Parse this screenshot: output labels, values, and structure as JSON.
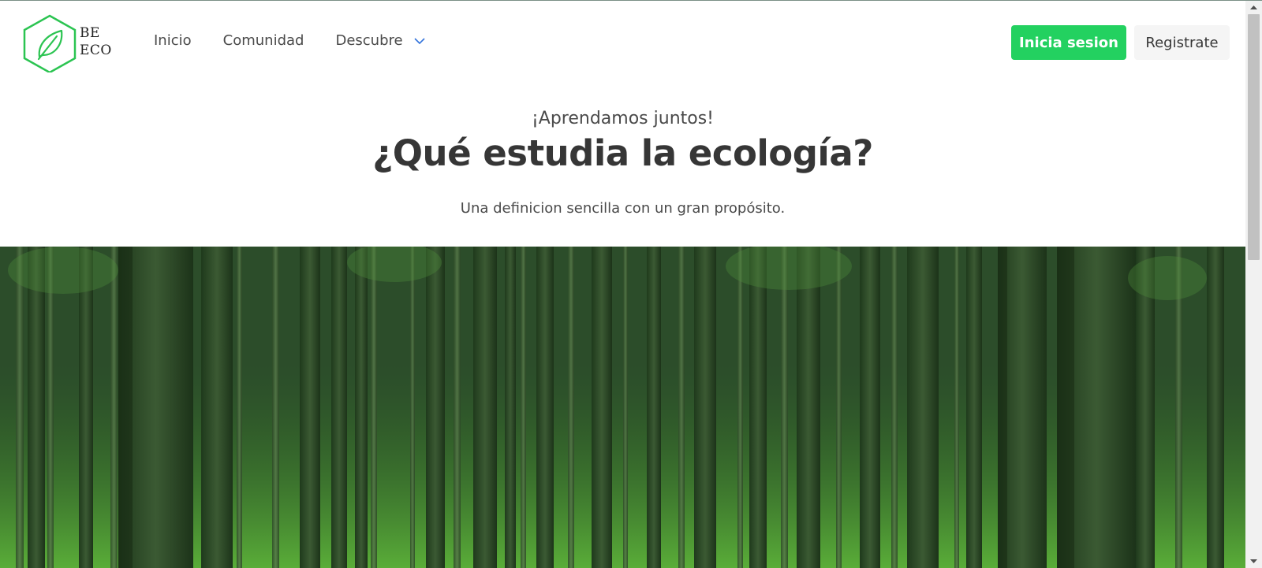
{
  "brand": {
    "line1": "BE",
    "line2": "ECO",
    "color": "#2bc451"
  },
  "nav": {
    "items": [
      {
        "label": "Inicio"
      },
      {
        "label": "Comunidad"
      }
    ],
    "dropdown_label": "Descubre",
    "dropdown_icon": "chevron-down-icon"
  },
  "auth": {
    "login_label": "Inicia sesion",
    "register_label": "Registrate",
    "login_color": "#23d160"
  },
  "hero": {
    "kicker": "¡Aprendamos juntos!",
    "title": "¿Qué estudia la ecología?",
    "description": "Una definicion sencilla con un gran propósito."
  },
  "colors": {
    "text": "#363636",
    "muted": "#4a4a4a",
    "register_bg": "#f5f5f5"
  }
}
